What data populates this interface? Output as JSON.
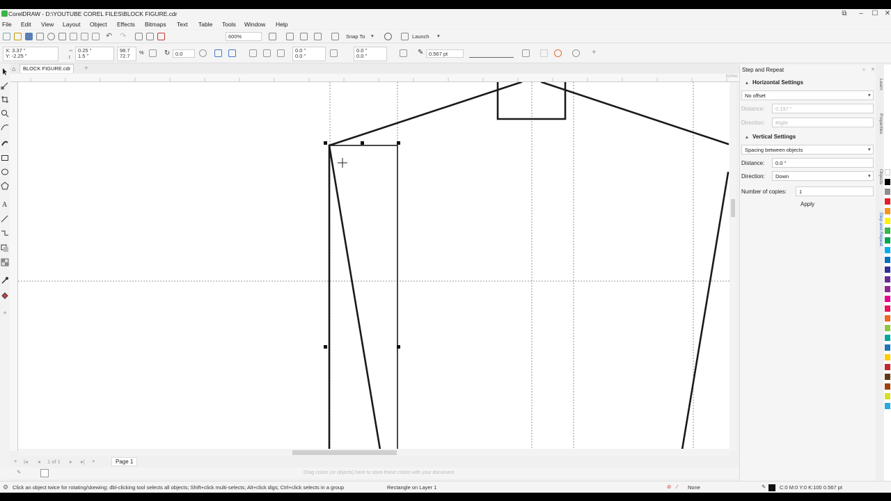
{
  "window": {
    "title": "CorelDRAW - D:\\YOUTUBE COREL FILES\\BLOCK FIGURE.cdr",
    "controls": [
      "⧉",
      "–",
      "☐",
      "✕"
    ]
  },
  "menu": [
    "File",
    "Edit",
    "View",
    "Layout",
    "Object",
    "Effects",
    "Bitmaps",
    "Text",
    "Table",
    "Tools",
    "Window",
    "Help"
  ],
  "toolbar": {
    "zoom": "600%",
    "snap_to": "Snap To",
    "launch": "Launch"
  },
  "properties": {
    "x": "X: 3.37 \"",
    "y": "Y: -2.25 \"",
    "width": "0.25 \"",
    "height": "1.5 \"",
    "scale_w": "98.7",
    "scale_h": "72.7",
    "scale_unit": "%",
    "rotation": "0.0",
    "corner_a1": "0.0 \"",
    "corner_a2": "0.0 \"",
    "corner_b1": "0.0 \"",
    "corner_b2": "0.0 \"",
    "outline_width": "0.567 pt"
  },
  "document": {
    "tab_label": "BLOCK FIGURE.cdr",
    "add_tab": "+",
    "ruler_unit": "inches"
  },
  "page_nav": {
    "counter": "1 of 1",
    "page_tab": "Page 1"
  },
  "palette_hint": "Drag colors (or objects) here to store these colors with your document",
  "docker": {
    "title": "Step and Repeat",
    "horizontal": {
      "header": "Horizontal Settings",
      "mode": "No offset",
      "distance_label": "Distance:",
      "distance_value": "0.197 \"",
      "direction_label": "Direction:",
      "direction_value": "Right"
    },
    "vertical": {
      "header": "Vertical Settings",
      "mode": "Spacing between objects",
      "distance_label": "Distance:",
      "distance_value": "0.0 \"",
      "direction_label": "Direction:",
      "direction_value": "Down"
    },
    "copies_label": "Number of copies:",
    "copies_value": "1",
    "apply": "Apply",
    "side_tabs": [
      "Learn",
      "Properties",
      "Objects",
      "Step and Repeat"
    ]
  },
  "status": {
    "hint": "Click an object twice for rotating/skewing; dbl-clicking tool selects all objects; Shift+click multi-selects; Alt+click digs; Ctrl+click selects in a group",
    "object_info": "Rectangle on Layer 1",
    "fill": "None",
    "outline": "C:0 M:0 Y:0 K:100  0.567 pt"
  },
  "colors": {
    "accent": "#3db34a",
    "selection": "#000000",
    "palette": [
      "#ffffff",
      "#000000",
      "#8e8e8e",
      "#e31e24",
      "#f7941d",
      "#fff200",
      "#39b54a",
      "#00a651",
      "#00aeef",
      "#0072bc",
      "#2e3192",
      "#662d91",
      "#92278f",
      "#ec008c",
      "#ed145b",
      "#f26522",
      "#8dc63f",
      "#00a99d",
      "#1b75bc",
      "#ffcc00",
      "#c1272d",
      "#603913",
      "#a0410d",
      "#d7df23",
      "#27aae1"
    ]
  },
  "icons": {
    "window": [
      "restore-icon",
      "minimize-icon",
      "maximize-icon",
      "close-icon"
    ],
    "tools": [
      "pick-icon",
      "shape-icon",
      "crop-icon",
      "zoom-icon",
      "freehand-icon",
      "artistic-media-icon",
      "rectangle-icon",
      "ellipse-icon",
      "polygon-icon",
      "text-icon",
      "parallel-dimension-icon",
      "connector-icon",
      "drop-shadow-icon",
      "transparency-icon",
      "eyedropper-icon",
      "interactive-fill-icon",
      "smart-fill-icon"
    ]
  }
}
